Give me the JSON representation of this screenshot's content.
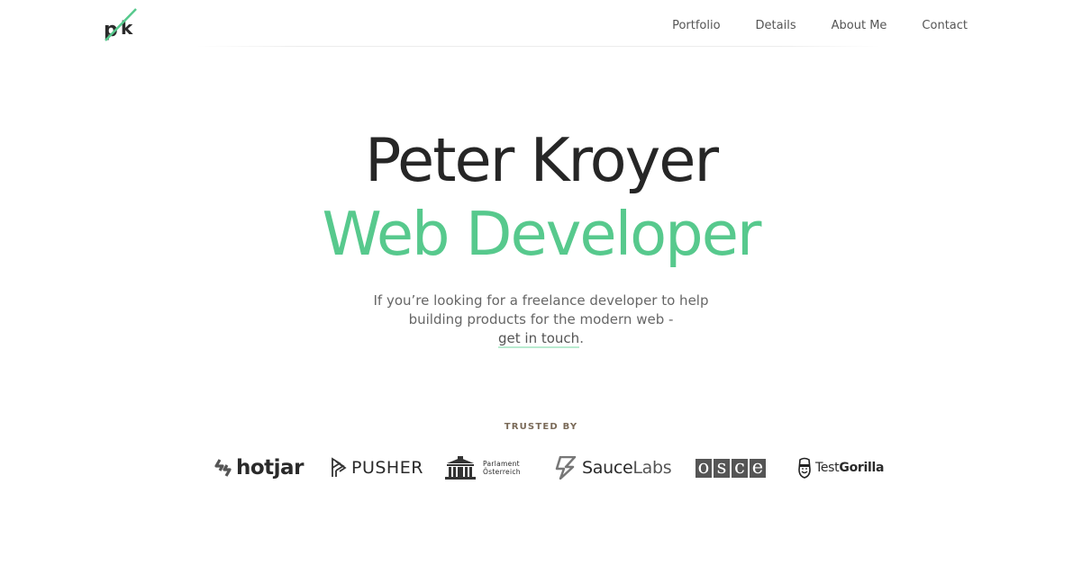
{
  "header": {
    "logo_alt": "pk",
    "nav": [
      "Portfolio",
      "Details",
      "About Me",
      "Contact"
    ]
  },
  "hero": {
    "name": "Peter Kroyer",
    "role": "Web Developer",
    "intro_line1": "If you’re looking for a freelance developer to help",
    "intro_line2": "building products for the modern web -",
    "intro_link": "get in touch",
    "intro_end": "."
  },
  "trusted": {
    "label": "TRUSTED BY",
    "clients": {
      "hotjar": "hotjar",
      "pusher": "PUSHER",
      "parlament_line1": "Parlament",
      "parlament_line2": "Österreich",
      "saucelabs_a": "Sauce",
      "saucelabs_b": "Labs",
      "osce": [
        "o",
        "s",
        "c",
        "e"
      ],
      "testgorilla_a": "Test",
      "testgorilla_b": "Gorilla"
    }
  },
  "colors": {
    "accent": "#57c98d",
    "text": "#262626",
    "muted": "#666666"
  }
}
